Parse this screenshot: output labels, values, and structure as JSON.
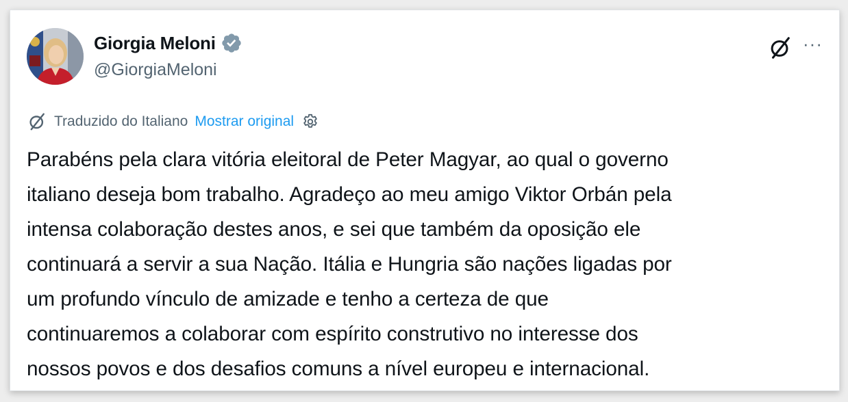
{
  "tweet": {
    "author_name": "Giorgia Meloni",
    "author_handle": "@GiorgiaMeloni",
    "translation_label": "Traduzido do Italiano",
    "show_original_label": "Mostrar original",
    "text": "Parabéns pela clara vitória eleitoral de Peter Magyar, ao qual o governo\nitaliano deseja bom trabalho. Agradeço ao meu amigo Viktor Orbán pela\nintensa colaboração destes anos, e sei que também da oposição ele\ncontinuará a servir a sua Nação. Itália e Hungria são nações ligadas por\num profundo vínculo de amizade e tenho a certeza de que\ncontinuaremos a colaborar com espírito construtivo no interesse dos\nnossos povos e dos desafios comuns a nível europeu e internacional.",
    "more_label": "···"
  },
  "icons": {
    "avatar": "avatar",
    "verified": "verified-badge-icon",
    "grok": "grok-icon",
    "more": "more-icon",
    "translated": "grok-icon",
    "settings": "gear-icon"
  },
  "colors": {
    "text": "#0f1419",
    "secondary": "#536471",
    "link": "#1d9bf0",
    "verified": "#829aab"
  }
}
